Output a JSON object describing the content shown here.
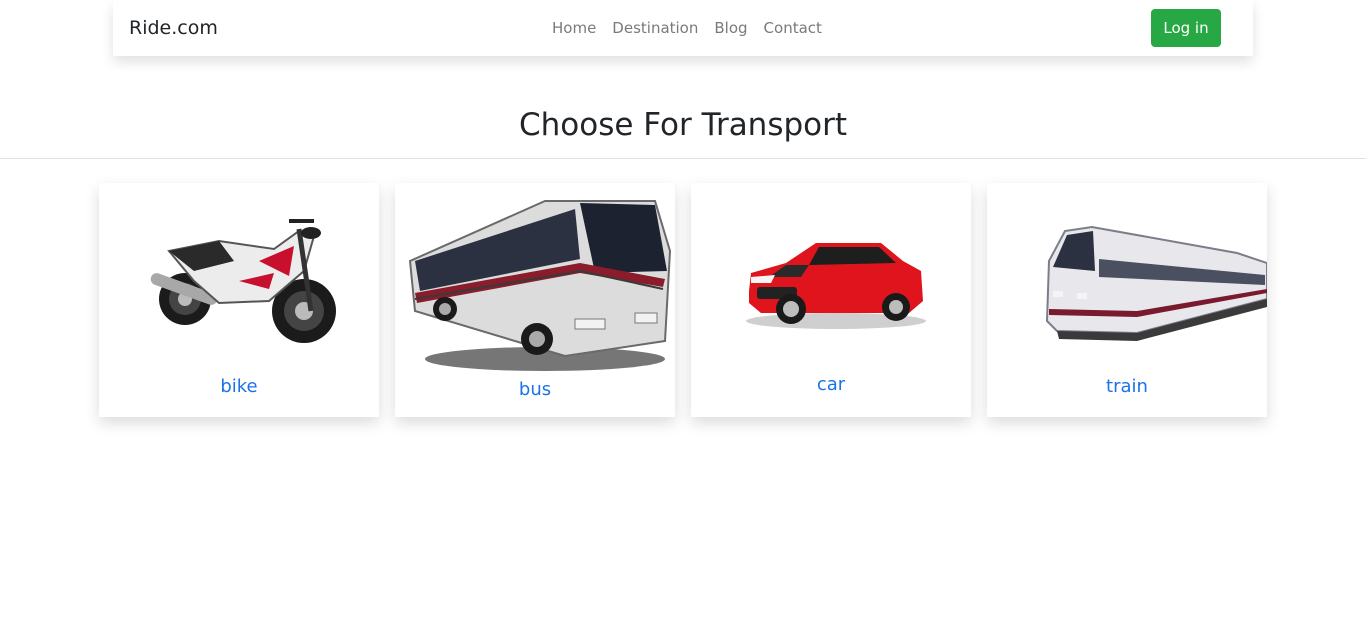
{
  "navbar": {
    "brand": "Ride.com",
    "links": [
      "Home",
      "Destination",
      "Blog",
      "Contact"
    ],
    "login_label": "Log in"
  },
  "main": {
    "title": "Choose For Transport"
  },
  "cards": [
    {
      "label": "bike",
      "image": "motorcycle"
    },
    {
      "label": "bus",
      "image": "bus"
    },
    {
      "label": "car",
      "image": "car"
    },
    {
      "label": "train",
      "image": "train"
    }
  ],
  "colors": {
    "accent_link": "#1a73e8",
    "login_button": "#28a745",
    "nav_link": "#7a7a7a",
    "car_body": "#e0141c"
  }
}
